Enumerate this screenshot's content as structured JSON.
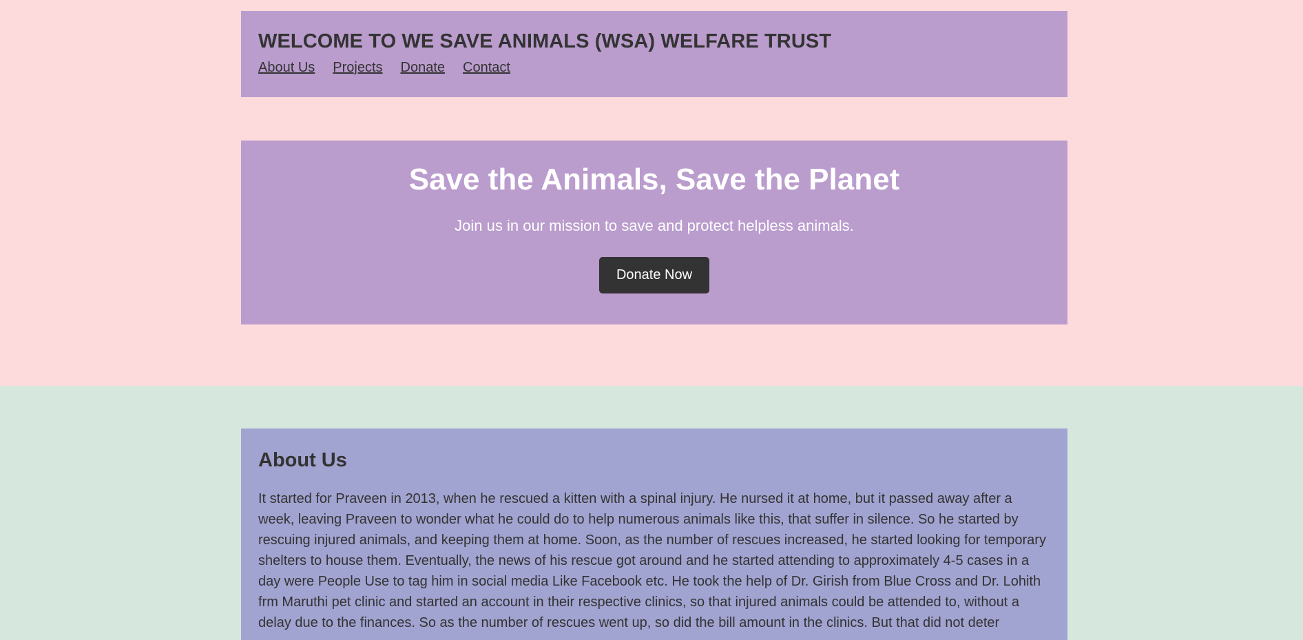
{
  "header": {
    "title": "WELCOME TO WE SAVE ANIMALS (WSA) WELFARE TRUST",
    "nav": [
      {
        "label": "About Us"
      },
      {
        "label": " Projects"
      },
      {
        "label": " Donate"
      },
      {
        "label": " Contact"
      }
    ]
  },
  "hero": {
    "title": "Save the Animals, Save the Planet",
    "subtitle": "Join us in our mission to save and protect helpless animals.",
    "button_label": "Donate Now"
  },
  "about": {
    "title": "About Us",
    "text": "It started for Praveen in 2013, when he rescued a kitten with a spinal injury. He nursed it at home, but it passed away after a week, leaving Praveen to wonder what he could do to help numerous animals like this, that suffer in silence. So he started by rescuing injured animals, and keeping them at home. Soon, as the number of rescues increased, he started looking for temporary shelters to house them. Eventually, the news of his rescue got around and he started attending to approximately 4-5 cases in a day were People Use to tag him in social media Like Facebook etc. He took the help of Dr. Girish from Blue Cross and Dr. Lohith frm Maruthi pet clinic and started an account in their respective clinics, so that injured animals could be attended to, without a delay due to the finances. So as the number of rescues went up, so did the bill amount in the clinics. But that did not deter"
  },
  "colors": {
    "page_top_bg": "#fddadb",
    "page_bottom_bg": "#d6e7dd",
    "header_bg": "#ba9ccd",
    "about_bg": "#a1a3d0",
    "text": "#333333",
    "button_bg": "#333333"
  }
}
